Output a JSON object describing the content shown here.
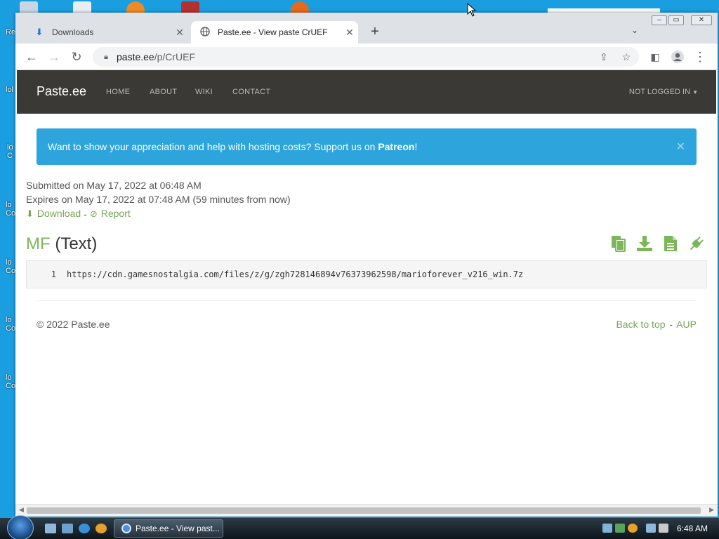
{
  "desktop": {
    "labels": [
      "Re",
      "lol",
      "lo C",
      "lo Co",
      "lo Co",
      "lo Co",
      "lo Co"
    ]
  },
  "browser": {
    "tabs": [
      {
        "title": "Downloads",
        "icon": "download-icon",
        "active": false
      },
      {
        "title": "Paste.ee - View paste CrUEF",
        "icon": "globe-icon",
        "active": true
      }
    ],
    "address": {
      "domain": "paste.ee",
      "path": "/p/CrUEF"
    }
  },
  "site": {
    "brand": "Paste.ee",
    "nav": [
      "HOME",
      "ABOUT",
      "WIKI",
      "CONTACT"
    ],
    "user_menu": "NOT LOGGED IN",
    "alert": {
      "text": "Want to show your appreciation and help with hosting costs? Support us on ",
      "link": "Patreon",
      "suffix": "!"
    },
    "submitted": "Submitted on May 17, 2022 at 06:48 AM",
    "expires": "Expires on May 17, 2022 at 07:48 AM (59 minutes from now)",
    "actions": {
      "download": "Download",
      "separator": "-",
      "report": "Report"
    },
    "paste": {
      "name": "MF",
      "type": "(Text)",
      "lines": [
        {
          "number": "1",
          "text": "https://cdn.gamesnostalgia.com/files/z/g/zgh728146894v76373962598/marioforever_v216_win.7z"
        }
      ]
    },
    "footer": {
      "copyright": "© 2022 Paste.ee",
      "back_to_top": "Back to top",
      "separator": "-",
      "aup": "AUP"
    },
    "colors": {
      "navbar": "#3a3935",
      "alert": "#2ea4dd",
      "accent_green": "#7cb65a"
    }
  },
  "taskbar": {
    "task": "Paste.ee - View past...",
    "clock": "6:48 AM"
  }
}
